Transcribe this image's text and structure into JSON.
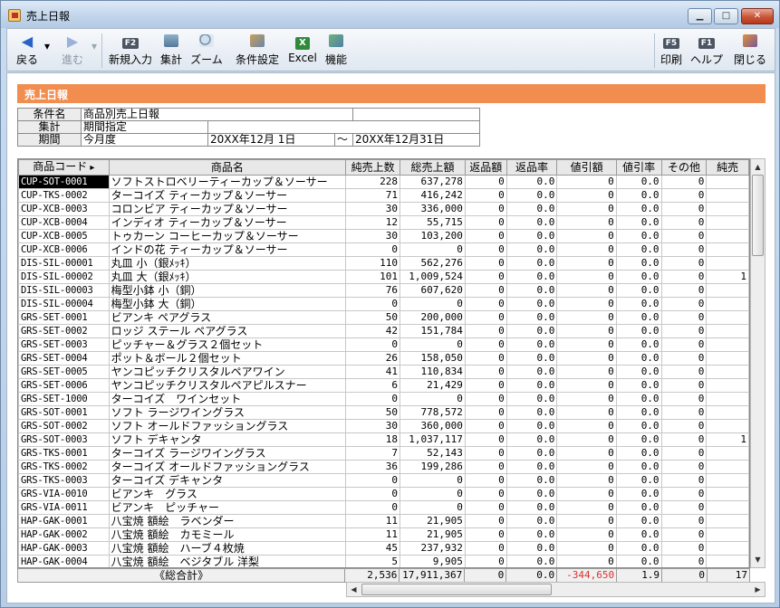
{
  "window": {
    "title": "売上日報"
  },
  "toolbar": {
    "back": "戻る",
    "forward": "進む",
    "new_entry": "新規入力",
    "tally": "集計",
    "zoom": "ズーム",
    "condition": "条件設定",
    "excel": "Excel",
    "function": "機能",
    "print": "印刷",
    "help": "ヘルプ",
    "close": "閉じる",
    "key_f2": "F2",
    "key_f5": "F5",
    "key_f1": "F1"
  },
  "report": {
    "title": "売上日報"
  },
  "conditions": {
    "row1_label": "条件名",
    "row1_value": "商品別売上日報",
    "row2_label": "集計",
    "row2_value": "期間指定",
    "row3_label": "期間",
    "row3_value": "今月度",
    "date_from": "20XX年12月 1日",
    "tilde": "～",
    "date_to": "20XX年12月31日"
  },
  "columns": [
    "商品コード",
    "商品名",
    "純売上数",
    "総売上額",
    "返品額",
    "返品率",
    "値引額",
    "値引率",
    "その他",
    "純売"
  ],
  "rows": [
    {
      "code": "CUP-SOT-0001",
      "name": "ソフトストロベリーティーカップ＆ソーサー",
      "qty": "228",
      "gross": "637,278",
      "ret": "0",
      "retr": "0.0",
      "disc": "0",
      "discr": "0.0",
      "other": "0",
      "net": ""
    },
    {
      "code": "CUP-TKS-0002",
      "name": "ターコイズ ティーカップ＆ソーサー",
      "qty": "71",
      "gross": "416,242",
      "ret": "0",
      "retr": "0.0",
      "disc": "0",
      "discr": "0.0",
      "other": "0",
      "net": ""
    },
    {
      "code": "CUP-XCB-0003",
      "name": "コロンビア ティーカップ＆ソーサー",
      "qty": "30",
      "gross": "336,000",
      "ret": "0",
      "retr": "0.0",
      "disc": "0",
      "discr": "0.0",
      "other": "0",
      "net": ""
    },
    {
      "code": "CUP-XCB-0004",
      "name": "インディオ ティーカップ＆ソーサー",
      "qty": "12",
      "gross": "55,715",
      "ret": "0",
      "retr": "0.0",
      "disc": "0",
      "discr": "0.0",
      "other": "0",
      "net": ""
    },
    {
      "code": "CUP-XCB-0005",
      "name": "トゥカーン コーヒーカップ＆ソーサー",
      "qty": "30",
      "gross": "103,200",
      "ret": "0",
      "retr": "0.0",
      "disc": "0",
      "discr": "0.0",
      "other": "0",
      "net": ""
    },
    {
      "code": "CUP-XCB-0006",
      "name": "インドの花 ティーカップ＆ソーサー",
      "qty": "0",
      "gross": "0",
      "ret": "0",
      "retr": "0.0",
      "disc": "0",
      "discr": "0.0",
      "other": "0",
      "net": ""
    },
    {
      "code": "DIS-SIL-00001",
      "name": "丸皿 小（銀ﾒｯｷ）",
      "qty": "110",
      "gross": "562,276",
      "ret": "0",
      "retr": "0.0",
      "disc": "0",
      "discr": "0.0",
      "other": "0",
      "net": ""
    },
    {
      "code": "DIS-SIL-00002",
      "name": "丸皿 大（銀ﾒｯｷ）",
      "qty": "101",
      "gross": "1,009,524",
      "ret": "0",
      "retr": "0.0",
      "disc": "0",
      "discr": "0.0",
      "other": "0",
      "net": "1"
    },
    {
      "code": "DIS-SIL-00003",
      "name": "梅型小鉢 小（銅）",
      "qty": "76",
      "gross": "607,620",
      "ret": "0",
      "retr": "0.0",
      "disc": "0",
      "discr": "0.0",
      "other": "0",
      "net": ""
    },
    {
      "code": "DIS-SIL-00004",
      "name": "梅型小鉢 大（銅）",
      "qty": "0",
      "gross": "0",
      "ret": "0",
      "retr": "0.0",
      "disc": "0",
      "discr": "0.0",
      "other": "0",
      "net": ""
    },
    {
      "code": "GRS-SET-0001",
      "name": "ビアンキ ペアグラス",
      "qty": "50",
      "gross": "200,000",
      "ret": "0",
      "retr": "0.0",
      "disc": "0",
      "discr": "0.0",
      "other": "0",
      "net": ""
    },
    {
      "code": "GRS-SET-0002",
      "name": "ロッジ ステール ペアグラス",
      "qty": "42",
      "gross": "151,784",
      "ret": "0",
      "retr": "0.0",
      "disc": "0",
      "discr": "0.0",
      "other": "0",
      "net": ""
    },
    {
      "code": "GRS-SET-0003",
      "name": "ピッチャー＆グラス２個セット",
      "qty": "0",
      "gross": "0",
      "ret": "0",
      "retr": "0.0",
      "disc": "0",
      "discr": "0.0",
      "other": "0",
      "net": ""
    },
    {
      "code": "GRS-SET-0004",
      "name": "ポット＆ボール２個セット",
      "qty": "26",
      "gross": "158,050",
      "ret": "0",
      "retr": "0.0",
      "disc": "0",
      "discr": "0.0",
      "other": "0",
      "net": ""
    },
    {
      "code": "GRS-SET-0005",
      "name": "ヤンコピッチクリスタルペアワイン",
      "qty": "41",
      "gross": "110,834",
      "ret": "0",
      "retr": "0.0",
      "disc": "0",
      "discr": "0.0",
      "other": "0",
      "net": ""
    },
    {
      "code": "GRS-SET-0006",
      "name": "ヤンコピッチクリスタルペアピルスナー",
      "qty": "6",
      "gross": "21,429",
      "ret": "0",
      "retr": "0.0",
      "disc": "0",
      "discr": "0.0",
      "other": "0",
      "net": ""
    },
    {
      "code": "GRS-SET-1000",
      "name": "ターコイズ　ワインセット",
      "qty": "0",
      "gross": "0",
      "ret": "0",
      "retr": "0.0",
      "disc": "0",
      "discr": "0.0",
      "other": "0",
      "net": ""
    },
    {
      "code": "GRS-SOT-0001",
      "name": "ソフト ラージワイングラス",
      "qty": "50",
      "gross": "778,572",
      "ret": "0",
      "retr": "0.0",
      "disc": "0",
      "discr": "0.0",
      "other": "0",
      "net": ""
    },
    {
      "code": "GRS-SOT-0002",
      "name": "ソフト オールドファッショングラス",
      "qty": "30",
      "gross": "360,000",
      "ret": "0",
      "retr": "0.0",
      "disc": "0",
      "discr": "0.0",
      "other": "0",
      "net": ""
    },
    {
      "code": "GRS-SOT-0003",
      "name": "ソフト デキャンタ",
      "qty": "18",
      "gross": "1,037,117",
      "ret": "0",
      "retr": "0.0",
      "disc": "0",
      "discr": "0.0",
      "other": "0",
      "net": "1"
    },
    {
      "code": "GRS-TKS-0001",
      "name": "ターコイズ ラージワイングラス",
      "qty": "7",
      "gross": "52,143",
      "ret": "0",
      "retr": "0.0",
      "disc": "0",
      "discr": "0.0",
      "other": "0",
      "net": ""
    },
    {
      "code": "GRS-TKS-0002",
      "name": "ターコイズ オールドファッショングラス",
      "qty": "36",
      "gross": "199,286",
      "ret": "0",
      "retr": "0.0",
      "disc": "0",
      "discr": "0.0",
      "other": "0",
      "net": ""
    },
    {
      "code": "GRS-TKS-0003",
      "name": "ターコイズ デキャンタ",
      "qty": "0",
      "gross": "0",
      "ret": "0",
      "retr": "0.0",
      "disc": "0",
      "discr": "0.0",
      "other": "0",
      "net": ""
    },
    {
      "code": "GRS-VIA-0010",
      "name": "ビアンキ　グラス",
      "qty": "0",
      "gross": "0",
      "ret": "0",
      "retr": "0.0",
      "disc": "0",
      "discr": "0.0",
      "other": "0",
      "net": ""
    },
    {
      "code": "GRS-VIA-0011",
      "name": "ビアンキ　ピッチャー",
      "qty": "0",
      "gross": "0",
      "ret": "0",
      "retr": "0.0",
      "disc": "0",
      "discr": "0.0",
      "other": "0",
      "net": ""
    },
    {
      "code": "HAP-GAK-0001",
      "name": "八宝焼 額絵　ラベンダー",
      "qty": "11",
      "gross": "21,905",
      "ret": "0",
      "retr": "0.0",
      "disc": "0",
      "discr": "0.0",
      "other": "0",
      "net": ""
    },
    {
      "code": "HAP-GAK-0002",
      "name": "八宝焼 額絵　カモミール",
      "qty": "11",
      "gross": "21,905",
      "ret": "0",
      "retr": "0.0",
      "disc": "0",
      "discr": "0.0",
      "other": "0",
      "net": ""
    },
    {
      "code": "HAP-GAK-0003",
      "name": "八宝焼 額絵　ハーブ４枚焼",
      "qty": "45",
      "gross": "237,932",
      "ret": "0",
      "retr": "0.0",
      "disc": "0",
      "discr": "0.0",
      "other": "0",
      "net": ""
    },
    {
      "code": "HAP-GAK-0004",
      "name": "八宝焼 額絵　ベジタブル 洋梨",
      "qty": "5",
      "gross": "9,905",
      "ret": "0",
      "retr": "0.0",
      "disc": "0",
      "discr": "0.0",
      "other": "0",
      "net": ""
    }
  ],
  "totals": {
    "label": "《総合計》",
    "qty": "2,536",
    "gross": "17,911,367",
    "ret": "0",
    "retr": "0.0",
    "disc": "-344,650",
    "discr": "1.9",
    "other": "0",
    "net": "17"
  },
  "colors": {
    "header_bar": "#f08d4f",
    "negative": "#e03030",
    "selection": "#000000"
  }
}
